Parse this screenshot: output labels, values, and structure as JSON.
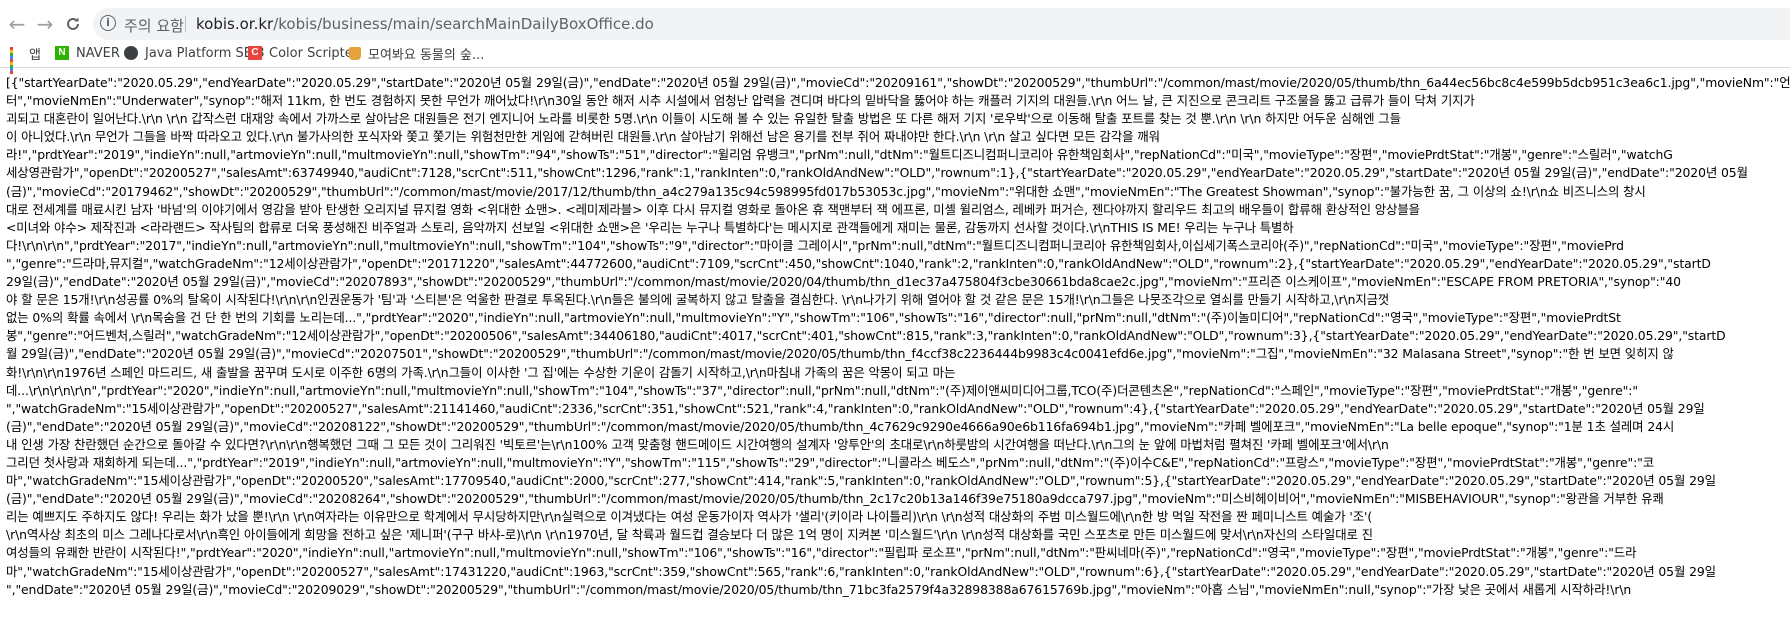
{
  "browser": {
    "back_glyph": "←",
    "forward_glyph": "→",
    "reload_glyph": "C",
    "info_glyph": "i",
    "security_label": "주의 요함",
    "url_host": "kobis.or.kr",
    "url_path": "/kobis/business/main/searchMainDailyBoxOffice.do"
  },
  "bookmarks": [
    {
      "label": "앱",
      "icon": "apps-grid-icon"
    },
    {
      "label": "NAVER",
      "icon": "naver-icon"
    },
    {
      "label": "Java Platform SE 8",
      "icon": "globe-icon"
    },
    {
      "label": "Color Scripter",
      "icon": "color-scripter-icon"
    },
    {
      "label": "모여봐요 동물의 숲...",
      "icon": "shopping-bag-icon"
    }
  ],
  "response_lines": [
    "[{\"startYearDate\":\"2020.05.29\",\"endYearDate\":\"2020.05.29\",\"startDate\":\"2020년 05월 29일(금)\",\"endDate\":\"2020년 05월 29일(금)\",\"movieCd\":\"20209161\",\"showDt\":\"20200529\",\"thumbUrl\":\"/common/mast/movie/2020/05/thumb/thn_6a44ec56bc8c4e599b5dcb951c3ea6c1.jpg\",\"movieNm\":\"언더워",
    "터\",\"movieNmEn\":\"Underwater\",\"synop\":\"해저 11km, 한 번도 경험하지 못한 무언가 깨어났다!\\r\\n30일 동안 해저 시추 시설에서 엄청난 압력을 견디며 바다의 밑바닥을 뚫어야 하는 캐플러 기지의 대원들.\\r\\n 어느 날, 큰 지진으로 콘크리트 구조물을 뚫고 급류가 들이 닥쳐 기지가",
    "괴되고 대혼란이 일어난다.\\r\\n \\r\\n 갑작스런 대재앙 속에서 가까스로 살아남은 대원들은 전기 엔지니어 노라를 비롯한 5명.\\r\\n 이들이 시도해 볼 수 있는 유일한 탈출 방법은 또 다른 해저 기지 '로우박'으로 이동해 탈출 포트를 찾는 것 뿐.\\r\\n \\r\\n 하지만 어두운 심해엔 그들",
    "이 아니었다.\\r\\n 무언가 그들을 바짝 따라오고 있다.\\r\\n 불가사의한 포식자와 쫓고 쫓기는 위험천만한 게임에 갇혀버린 대원들.\\r\\n 살아남기 위해선 남은 용기를 전부 쥐어 짜내야만 한다.\\r\\n \\r\\n 살고 싶다면 모든 감각을 깨워",
    "라!\",\"prdtYear\":\"2019\",\"indieYn\":null,\"artmovieYn\":null,\"multmovieYn\":null,\"showTm\":\"94\",\"showTs\":\"51\",\"director\":\"윌리엄 유뱅크\",\"prNm\":null,\"dtNm\":\"월트디즈니컴퍼니코리아 유한책임회사\",\"repNationCd\":\"미국\",\"movieType\":\"장편\",\"moviePrdtStat\":\"개봉\",\"genre\":\"스릴러\",\"watchG",
    "세상영관람가\",\"openDt\":\"20200527\",\"salesAmt\":63749940,\"audiCnt\":7128,\"scrCnt\":511,\"showCnt\":1296,\"rank\":1,\"rankInten\":0,\"rankOldAndNew\":\"OLD\",\"rownum\":1},{\"startYearDate\":\"2020.05.29\",\"endYearDate\":\"2020.05.29\",\"startDate\":\"2020년 05월 29일(금)\",\"endDate\":\"2020년 05월",
    "(금)\",\"movieCd\":\"20179462\",\"showDt\":\"20200529\",\"thumbUrl\":\"/common/mast/movie/2017/12/thumb/thn_a4c279a135c94c598995fd017b53053c.jpg\",\"movieNm\":\"위대한 쇼맨\",\"movieNmEn\":\"The Greatest Showman\",\"synop\":\"불가능한 꿈, 그 이상의 쇼!\\r\\n쇼 비즈니스의 창시",
    "대로 전세계를 매료시킨 남자 '바넘'의 이야기에서 영감을 받아 탄생한 오리지널 뮤지컬 영화 <위대한 쇼맨>. <레미제라블> 이후 다시 뮤지컬 영화로 돌아온 휴 잭맨부터 잭 에프론, 미셸 윌리엄스, 레베카 퍼거슨, 젠다야까지 할리우드 최고의 배우들이 합류해 환상적인 앙상블을 ",
    "<미녀와 야수> 제작진과 <라라랜드> 작사팀의 합류로 더욱 풍성해진 비주얼과 스토리, 음악까지 선보일 <위대한 쇼맨>은 '우리는 누구나 특별하다'는 메시지로 관객들에게 재미는 물론, 감동까지 선사할 것이다.\\r\\nTHIS IS ME! 우리는 누구나 특별하",
    "다!\\r\\n\\r\\n\",\"prdtYear\":\"2017\",\"indieYn\":null,\"artmovieYn\":null,\"multmovieYn\":null,\"showTm\":\"104\",\"showTs\":\"9\",\"director\":\"마이클 그레이시\",\"prNm\":null,\"dtNm\":\"월트디즈니컴퍼니코리아 유한책임회사,이십세기폭스코리아(주)\",\"repNationCd\":\"미국\",\"movieType\":\"장편\",\"moviePrd",
    "\",\"genre\":\"드라마,뮤지컬\",\"watchGradeNm\":\"12세이상관람가\",\"openDt\":\"20171220\",\"salesAmt\":44772600,\"audiCnt\":7109,\"scrCnt\":450,\"showCnt\":1040,\"rank\":2,\"rankInten\":0,\"rankOldAndNew\":\"OLD\",\"rownum\":2},{\"startYearDate\":\"2020.05.29\",\"endYearDate\":\"2020.05.29\",\"startD",
    "29일(금)\",\"endDate\":\"2020년 05월 29일(금)\",\"movieCd\":\"20207893\",\"showDt\":\"20200529\",\"thumbUrl\":\"/common/mast/movie/2020/04/thumb/thn_d1ec37a475804f3cbe30661bda8cae2c.jpg\",\"movieNm\":\"프리즌 이스케이프\",\"movieNmEn\":\"ESCAPE FROM PRETORIA\",\"synop\":\"40",
    "야 할 문은 15개!\\r\\n성공률 0%의 탈옥이 시작된다!\\r\\n\\r\\n인권운동가 '팀'과 '스티븐'은 억울한 판결로 투옥된다.\\r\\n들은 불의에 굴복하지 않고 탈출을 결심한다. \\r\\n나가기 위해 열어야 할 것 같은 문은 15개!\\r\\n그들은 나뭇조각으로 열쇠를 만들기 시작하고,\\r\\n지금껏",
    "없는 0%의 확률 속에서 \\r\\n목숨을 건 단 한 번의 기회를 노리는데...\",\"prdtYear\":\"2020\",\"indieYn\":null,\"artmovieYn\":null,\"multmovieYn\":\"Y\",\"showTm\":\"106\",\"showTs\":\"16\",\"director\":null,\"prNm\":null,\"dtNm\":\"(주)이놀미디어\",\"repNationCd\":\"영국\",\"movieType\":\"장편\",\"moviePrdtSt",
    "봉\",\"genre\":\"어드벤처,스릴러\",\"watchGradeNm\":\"12세이상관람가\",\"openDt\":\"20200506\",\"salesAmt\":34406180,\"audiCnt\":4017,\"scrCnt\":401,\"showCnt\":815,\"rank\":3,\"rankInten\":0,\"rankOldAndNew\":\"OLD\",\"rownum\":3},{\"startYearDate\":\"2020.05.29\",\"endYearDate\":\"2020.05.29\",\"startD",
    "월 29일(금)\",\"endDate\":\"2020년 05월 29일(금)\",\"movieCd\":\"20207501\",\"showDt\":\"20200529\",\"thumbUrl\":\"/common/mast/movie/2020/05/thumb/thn_f4ccf38c2236444b9983c4c0041efd6e.jpg\",\"movieNm\":\"그집\",\"movieNmEn\":\"32 Malasana Street\",\"synop\":\"한 번 보면 잊히지 않",
    "화!\\r\\n\\r\\n1976년 스페인 마드리드, 새 출발을 꿈꾸며 도시로 이주한 6명의 가족.\\r\\n그들이 이사한 '그 집'에는 수상한 기운이 감돌기 시작하고,\\r\\n마침내 가족의 꿈은 악몽이 되고 마는",
    "데...\\r\\n\\r\\n\\r\\n\",\"prdtYear\":\"2020\",\"indieYn\":null,\"artmovieYn\":null,\"multmovieYn\":null,\"showTm\":\"104\",\"showTs\":\"37\",\"director\":null,\"prNm\":null,\"dtNm\":\"(주)제이앤씨미디어그룹,TCO(주)더콘텐츠온\",\"repNationCd\":\"스페인\",\"movieType\":\"장편\",\"moviePrdtStat\":\"개봉\",\"genre\":\"",
    "\",\"watchGradeNm\":\"15세이상관람가\",\"openDt\":\"20200527\",\"salesAmt\":21141460,\"audiCnt\":2336,\"scrCnt\":351,\"showCnt\":521,\"rank\":4,\"rankInten\":0,\"rankOldAndNew\":\"OLD\",\"rownum\":4},{\"startYearDate\":\"2020.05.29\",\"endYearDate\":\"2020.05.29\",\"startDate\":\"2020년 05월 29일",
    "(금)\",\"endDate\":\"2020년 05월 29일(금)\",\"movieCd\":\"20208122\",\"showDt\":\"20200529\",\"thumbUrl\":\"/common/mast/movie/2020/05/thumb/thn_4c7629c9290e4666a90e6b116fa694b1.jpg\",\"movieNm\":\"카페 벨에포크\",\"movieNmEn\":\"La belle epoque\",\"synop\":\"1분 1초 설레며 24시",
    "내 인생 가장 찬란했던 순간으로 돌아갈 수 있다면?\\r\\n\\r\\n행복했던 그때 그 모든 것이 그리워진 '빅토르'는\\r\\n100% 고객 맞춤형 핸드메이드 시간여행의 설계자 '앙투안'의 초대로\\r\\n하룻밤의 시간여행을 떠난다.\\r\\n그의 눈 앞에 마법처럼 펼쳐진 '카페 벨에포크'에서\\r\\n",
    "그리던 첫사랑과 재회하게 되는데...\",\"prdtYear\":\"2019\",\"indieYn\":null,\"artmovieYn\":null,\"multmovieYn\":\"Y\",\"showTm\":\"115\",\"showTs\":\"29\",\"director\":\"니콜라스 베도스\",\"prNm\":null,\"dtNm\":\"(주)이수C&E\",\"repNationCd\":\"프랑스\",\"movieType\":\"장편\",\"moviePrdtStat\":\"개봉\",\"genre\":\"코",
    "마\",\"watchGradeNm\":\"15세이상관람가\",\"openDt\":\"20200520\",\"salesAmt\":17709540,\"audiCnt\":2000,\"scrCnt\":277,\"showCnt\":414,\"rank\":5,\"rankInten\":0,\"rankOldAndNew\":\"OLD\",\"rownum\":5},{\"startYearDate\":\"2020.05.29\",\"endYearDate\":\"2020.05.29\",\"startDate\":\"2020년 05월 29일",
    "(금)\",\"endDate\":\"2020년 05월 29일(금)\",\"movieCd\":\"20208264\",\"showDt\":\"20200529\",\"thumbUrl\":\"/common/mast/movie/2020/05/thumb/thn_2c17c20b13a146f39e75180a9dcca797.jpg\",\"movieNm\":\"미스비헤이비어\",\"movieNmEn\":\"MISBEHAVIOUR\",\"synop\":\"왕관을 거부한 유쾌",
    "리는 예쁘지도 주하지도 않다! 우리는 화가 났을 뿐!\\r\\n \\r\\n여자라는 이유만으로 학계에서 무시당하지만\\r\\n실력으로 이겨냈다는 여성 운동가이자 역사가 '샐리'(키이라 나이틀리)\\r\\n \\r\\n성적 대상화의 주범 미스월드에\\r\\n한 방 먹일 작전을 짠 페미니스트 예술가 '조'(",
    "\\r\\n역사상 최초의 미스 그레나다로서\\r\\n흑인 아이들에게 희망을 전하고 싶은 '제니퍼'(구구 바샤-로)\\r\\n \\r\\n1970년, 달 착륙과 월드컵 결승보다 더 많은 1억 명이 지켜본 '미스월드'\\r\\n \\r\\n성적 대상화를 국민 스포츠로 만든 미스월드에 맞서\\r\\n자신의 스타일대로 진",
    "여성들의 유쾌한 반란이 시작된다!\",\"prdtYear\":\"2020\",\"indieYn\":null,\"artmovieYn\":null,\"multmovieYn\":null,\"showTm\":\"106\",\"showTs\":\"16\",\"director\":\"필립파 로소프\",\"prNm\":null,\"dtNm\":\"판씨네마(주)\",\"repNationCd\":\"영국\",\"movieType\":\"장편\",\"moviePrdtStat\":\"개봉\",\"genre\":\"드라",
    "마\",\"watchGradeNm\":\"15세이상관람가\",\"openDt\":\"20200527\",\"salesAmt\":17431220,\"audiCnt\":1963,\"scrCnt\":359,\"showCnt\":565,\"rank\":6,\"rankInten\":0,\"rankOldAndNew\":\"OLD\",\"rownum\":6},{\"startYearDate\":\"2020.05.29\",\"endYearDate\":\"2020.05.29\",\"startDate\":\"2020년 05월 29일",
    "\",\"endDate\":\"2020년 05월 29일(금)\",\"movieCd\":\"20209029\",\"showDt\":\"20200529\",\"thumbUrl\":\"/common/mast/movie/2020/05/thumb/thn_71bc3fa2579f4a32898388a67615769b.jpg\",\"movieNm\":\"아홉 스님\",\"movieNmEn\":null,\"synop\":\"가장 낮은 곳에서 새롭게 시작하라!\\r\\n"
  ]
}
